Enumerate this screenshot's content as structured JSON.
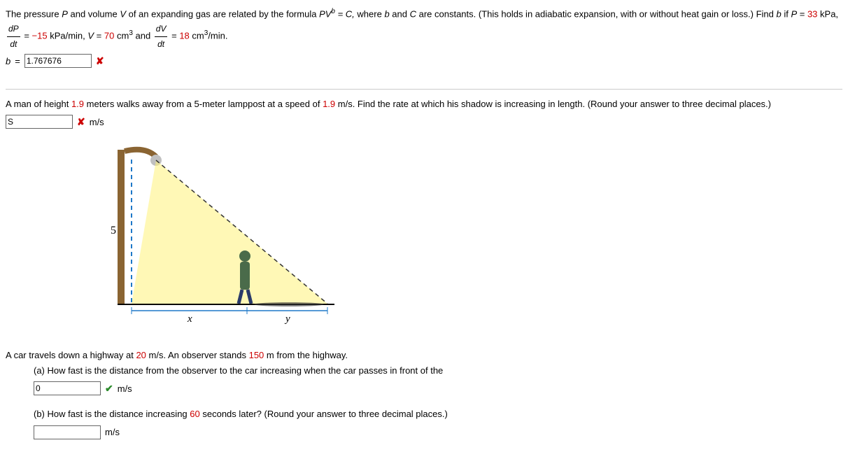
{
  "q1": {
    "text_a": "The pressure ",
    "P": "P",
    "text_b": " and volume ",
    "V": "V",
    "text_c": " of an expanding gas are related by the formula ",
    "formula": "PV",
    "sup_b": "b",
    "eq_c": " = C,",
    "text_d": " where ",
    "b": "b",
    "text_e": " and ",
    "C": "C",
    "text_f": " are constants. (This holds in adiabatic expansion, with or without heat gain or loss.) Find ",
    "b2": "b",
    "text_g": " if ",
    "P2": "P",
    "eq": " = ",
    "val_p": "33",
    "unit_p": " kPa, ",
    "frac1_num": "dP",
    "frac1_den": "dt",
    "val_dp": "−15",
    "unit_dp": " kPa/min, ",
    "V2": "V",
    "val_v": "70",
    "unit_v": " cm",
    "sup3": "3",
    "and": " and ",
    "frac2_num": "dV",
    "frac2_den": "dt",
    "val_dv": "18",
    "unit_dv": " cm",
    "per_min": "/min.",
    "answer_label": "b",
    "answer_eq": " = ",
    "answer_value": "1.767676"
  },
  "q2": {
    "text_a": "A man of height ",
    "height": "1.9",
    "text_b": " meters walks away from a 5-meter lamppost at a speed of ",
    "speed": "1.9",
    "text_c": " m/s. Find the rate at which his shadow is increasing in length. (Round your answer to three decimal places.)",
    "answer_value": "S",
    "unit": "m/s",
    "diagram": {
      "lamp_height": "5",
      "x": "x",
      "y": "y"
    }
  },
  "q3": {
    "text_a": "A car travels down a highway at ",
    "speed": "20",
    "text_b": " m/s. An observer stands ",
    "dist": "150",
    "text_c": " m from the highway.",
    "part_a": "(a) How fast is the distance from the observer to the car increasing when the car passes in front of the",
    "a_value": "0",
    "a_unit": "m/s",
    "part_b": "(b) How fast is the distance increasing ",
    "b_time": "60",
    "part_b2": " seconds later? (Round your answer to three decimal places.)",
    "b_value": "",
    "b_unit": "m/s"
  }
}
